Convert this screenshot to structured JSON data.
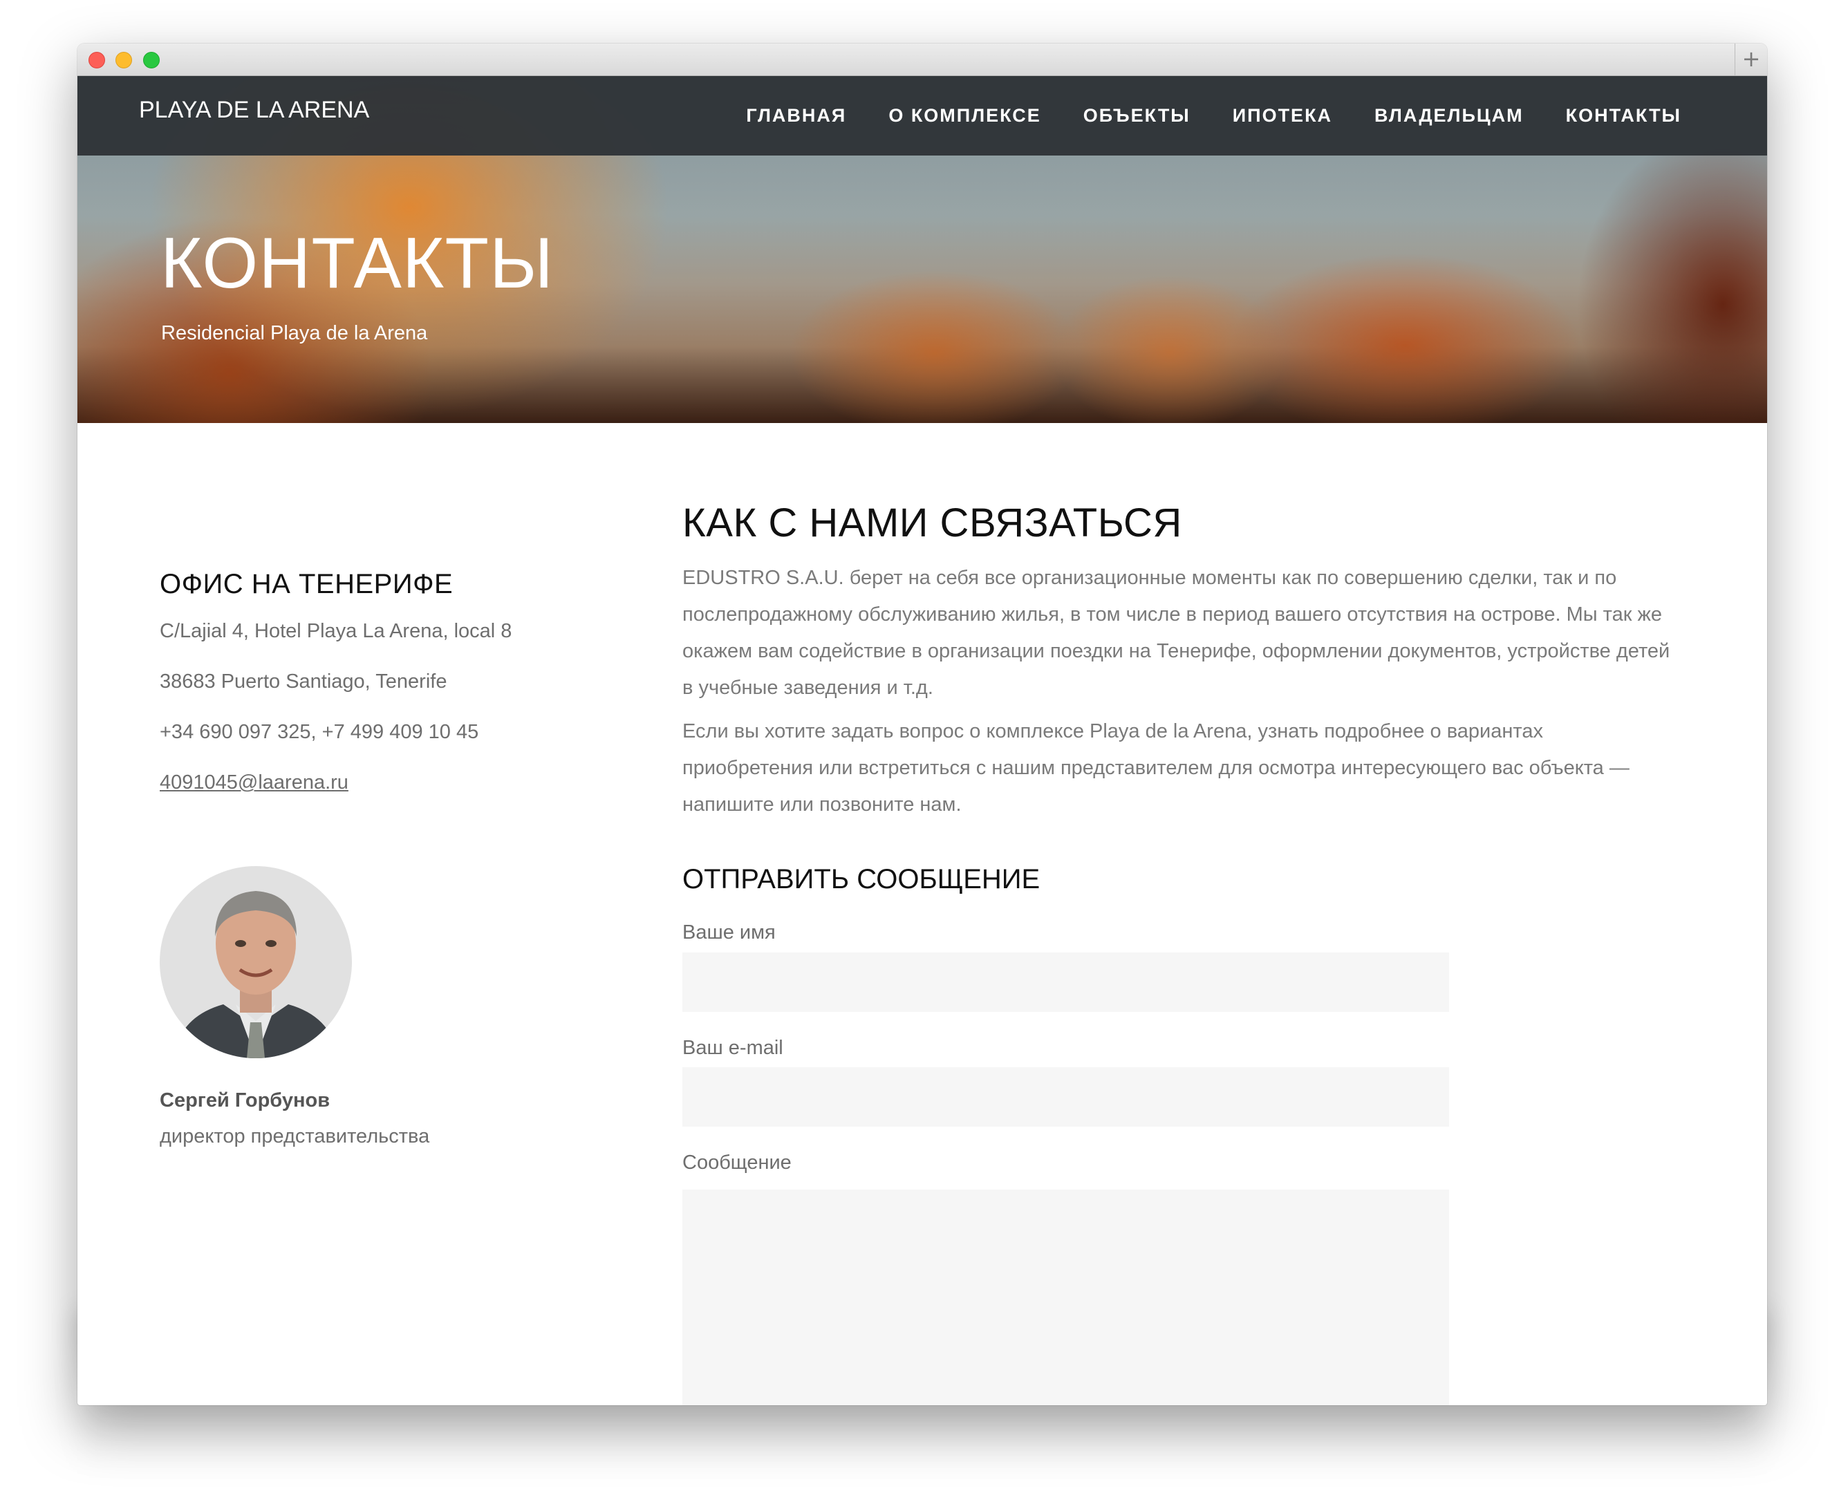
{
  "browser": {
    "new_tab_icon": "plus-icon"
  },
  "site": {
    "brand": "PLAYA DE LA ARENA",
    "nav": [
      "ГЛАВНАЯ",
      "О КОМПЛЕКСЕ",
      "ОБЪЕКТЫ",
      "ИПОТЕКА",
      "ВЛАДЕЛЬЦАМ",
      "КОНТАКТЫ"
    ]
  },
  "hero": {
    "title": "КОНТАКТЫ",
    "subtitle": "Residencial Playa de la Arena"
  },
  "office": {
    "title": "ОФИС НА ТЕНЕРИФЕ",
    "address1": "C/Lajial 4, Hotel Playa La Arena, local 8",
    "address2": "38683 Puerto Santiago, Tenerife",
    "phones": "+34 690 097 325, +7 499 409 10 45",
    "email": "4091045@laarena.ru"
  },
  "person": {
    "name": "Сергей Горбунов",
    "role": "директор представительства"
  },
  "contact": {
    "title": "КАК С НАМИ СВЯЗАТЬСЯ",
    "para1": "EDUSTRO S.A.U. берет на себя все организационные моменты как по совершению сделки, так и по послепродажному обслуживанию жилья, в том числе в период вашего отсутствия на острове. Мы так же окажем вам содействие в организации поездки на Тенерифе, оформлении документов, устройстве детей в учебные заведения и т.д.",
    "para2": "Если вы хотите задать вопрос о комплексе Playa de la Arena, узнать подробнее о вариантах приобретения или встретиться с нашим представителем для осмотра интересующего вас объекта — напишите или позвоните нам."
  },
  "form": {
    "title": "ОТПРАВИТЬ СООБЩЕНИЕ",
    "name_label": "Ваше имя",
    "email_label": "Ваш e-mail",
    "message_label": "Сообщение",
    "name_value": "",
    "email_value": "",
    "message_value": ""
  }
}
